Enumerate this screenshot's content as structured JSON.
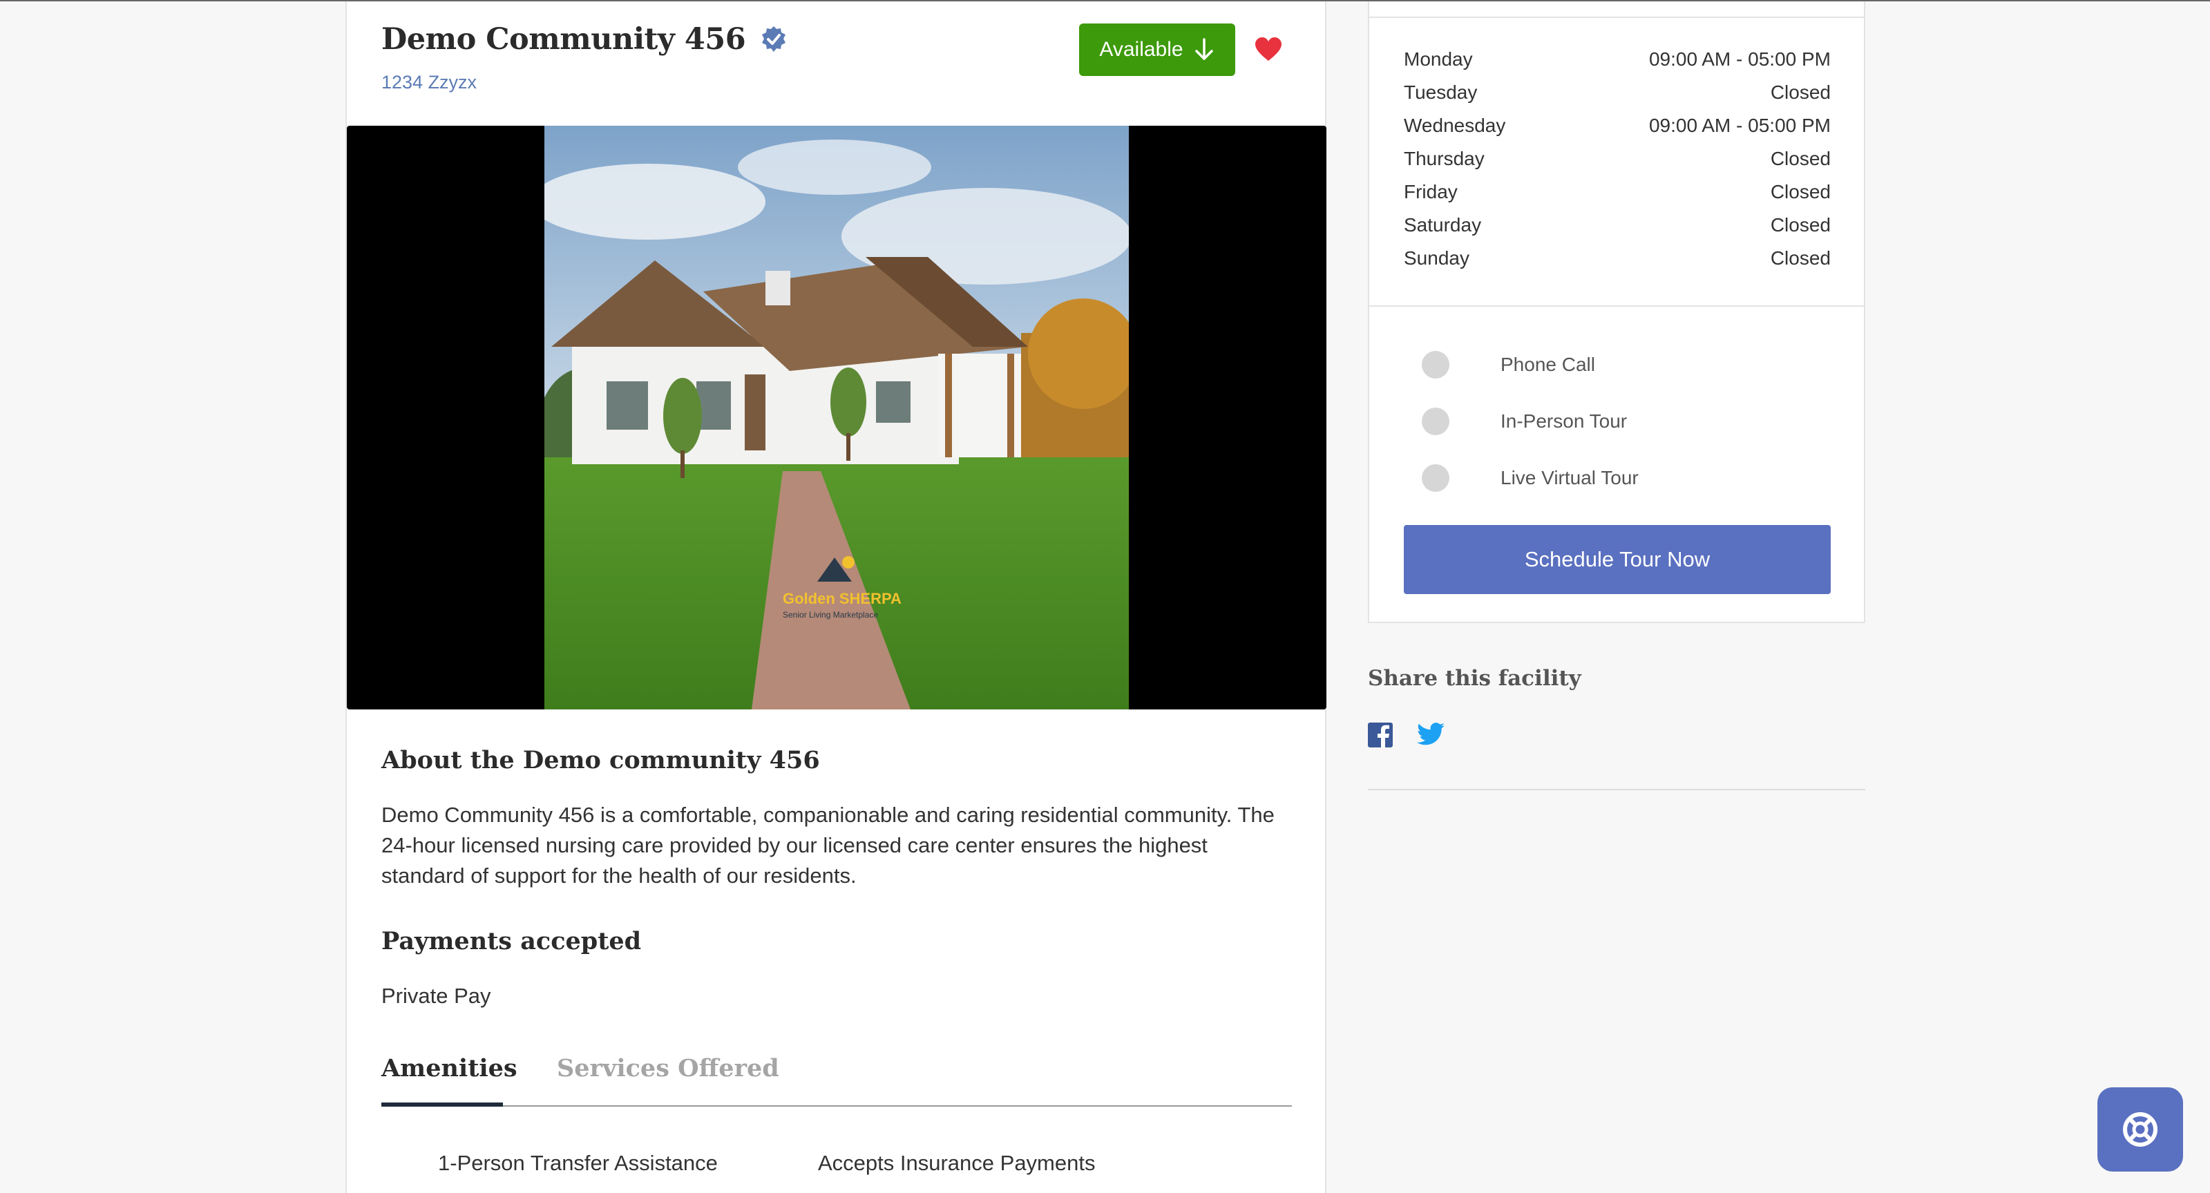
{
  "header": {
    "title": "Demo Community 456",
    "address": "1234 Zzyzx",
    "availability_label": "Available"
  },
  "photo": {
    "logo_text": "Golden SHERPA",
    "logo_subtext": "Senior Living Marketplace"
  },
  "about": {
    "heading": "About the Demo community 456",
    "text": "Demo Community 456 is a comfortable, companionable and caring residential community. The 24-hour licensed nursing care provided by our licensed care center ensures the highest standard of support for the health of our residents."
  },
  "payments": {
    "heading": "Payments accepted",
    "value": "Private Pay"
  },
  "tabs": [
    {
      "label": "Amenities",
      "active": true
    },
    {
      "label": "Services Offered",
      "active": false
    }
  ],
  "amenities": [
    "1-Person Transfer Assistance",
    "Accepts Insurance Payments"
  ],
  "hours": [
    {
      "day": "Monday",
      "time": "09:00 AM - 05:00 PM"
    },
    {
      "day": "Tuesday",
      "time": "Closed"
    },
    {
      "day": "Wednesday",
      "time": "09:00 AM - 05:00 PM"
    },
    {
      "day": "Thursday",
      "time": "Closed"
    },
    {
      "day": "Friday",
      "time": "Closed"
    },
    {
      "day": "Saturday",
      "time": "Closed"
    },
    {
      "day": "Sunday",
      "time": "Closed"
    }
  ],
  "tour_options": [
    "Phone Call",
    "In-Person Tour",
    "Live Virtual Tour"
  ],
  "schedule_button": "Schedule Tour Now",
  "share": {
    "heading": "Share this facility",
    "networks": [
      "facebook-icon",
      "twitter-icon"
    ]
  },
  "colors": {
    "accent": "#5a70c0",
    "available_green": "#3d9a0b",
    "heart_red": "#e8323e",
    "link_blue": "#5b7bb5"
  }
}
